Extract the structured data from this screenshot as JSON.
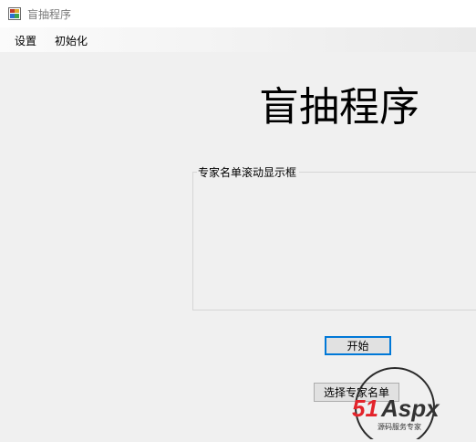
{
  "window": {
    "title": "盲抽程序",
    "icon": "app-icon"
  },
  "menu": {
    "items": [
      "设置",
      "初始化"
    ]
  },
  "main": {
    "heading": "盲抽程序",
    "group_label": "专家名单滚动显示框",
    "expert_list": []
  },
  "buttons": {
    "start": "开始",
    "choose": "选择专家名单"
  },
  "watermark": {
    "brand": "51Aspx",
    "slogan": "源码服务专家",
    "brand_red": "#e3242b",
    "brand_dark": "#333333"
  },
  "colors": {
    "focus_border": "#0078d7",
    "background": "#f0f0f0"
  }
}
